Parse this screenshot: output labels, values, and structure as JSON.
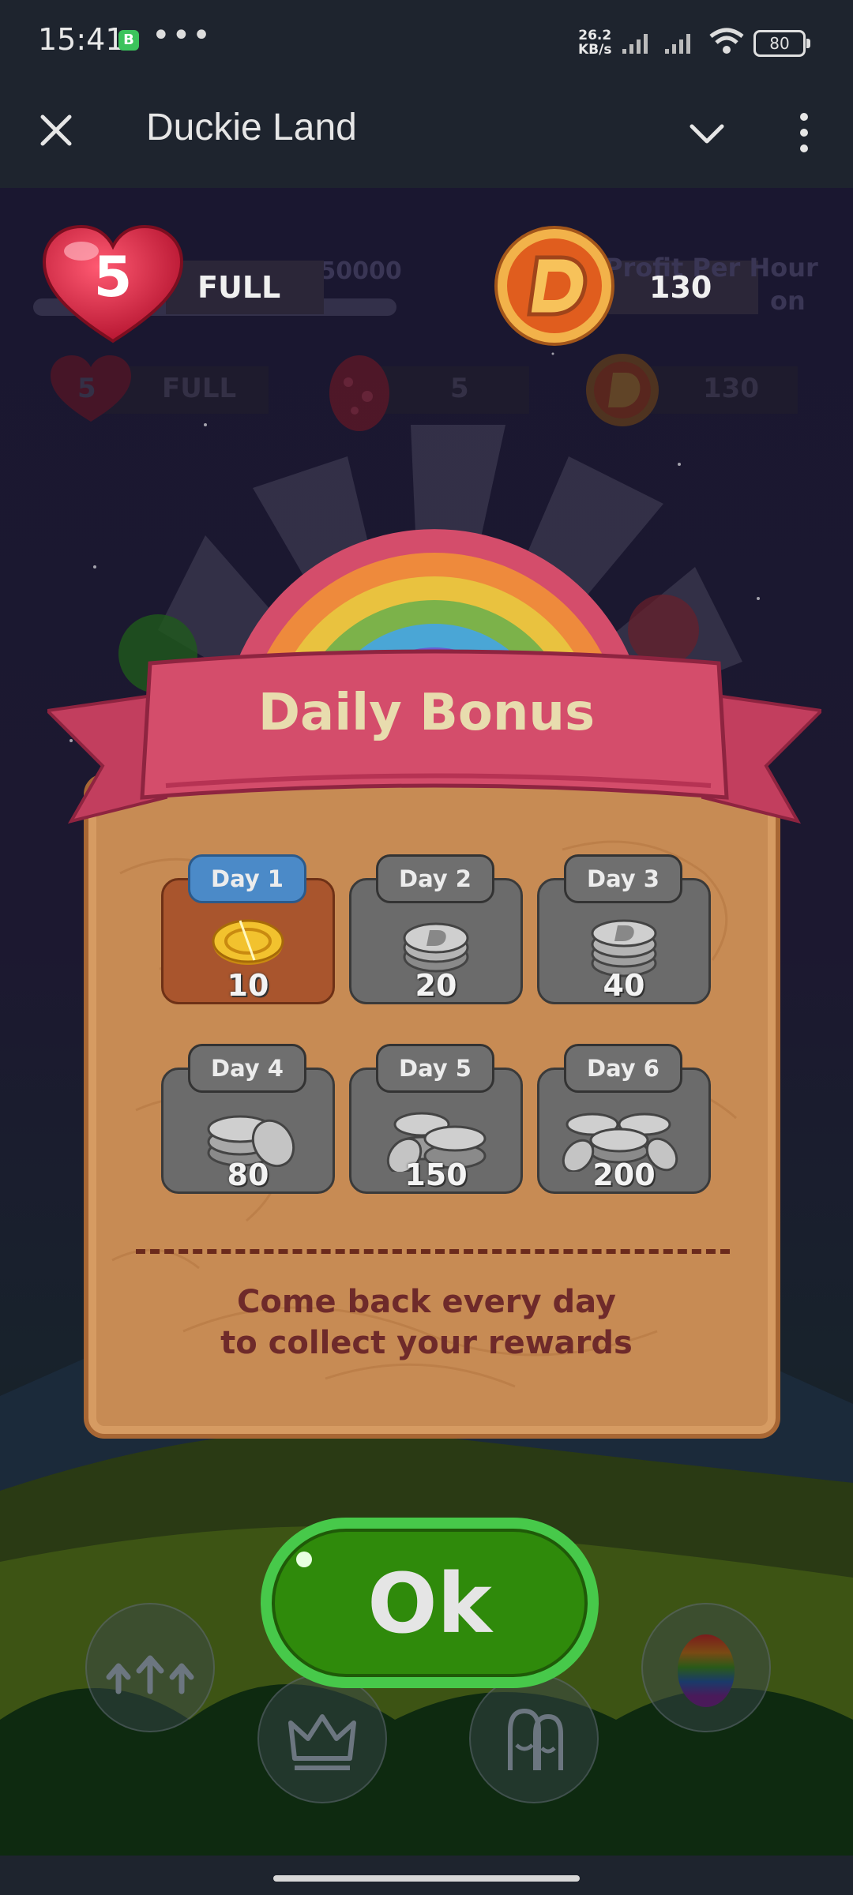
{
  "status_bar": {
    "time": "15:41",
    "app_badge": "B",
    "more": "•••",
    "speed_value": "26.2",
    "speed_unit": "KB/s",
    "battery": "80"
  },
  "app_bar": {
    "title": "Duckie Land",
    "close_icon": "close-icon",
    "expand_icon": "chevron-down-icon",
    "menu_icon": "more-vertical-icon"
  },
  "hud": {
    "lives_count": "5",
    "lives_status": "FULL",
    "xp_text": "e 130/50000",
    "coin_count": "130",
    "profit_text_1": "Profit Per Hour",
    "profit_text_2": "on",
    "dim_row": {
      "lives_count": "5",
      "lives_status": "FULL",
      "eggs": "5",
      "coins": "130"
    }
  },
  "dialog": {
    "title": "Daily Bonus",
    "days": [
      {
        "label": "Day 1",
        "amount": "10",
        "active": true
      },
      {
        "label": "Day 2",
        "amount": "20",
        "active": false
      },
      {
        "label": "Day 3",
        "amount": "40",
        "active": false
      },
      {
        "label": "Day 4",
        "amount": "80",
        "active": false
      },
      {
        "label": "Day 5",
        "amount": "150",
        "active": false
      },
      {
        "label": "Day 6",
        "amount": "200",
        "active": false
      }
    ],
    "message_line_1": "Come back every day",
    "message_line_2": "to collect your rewards",
    "ok_label": "Ok"
  },
  "colors": {
    "ribbon": "#d44d6b",
    "board": "#c78b54",
    "ok_button": "#2f8a0b",
    "active_tab": "#4b8ac8"
  }
}
